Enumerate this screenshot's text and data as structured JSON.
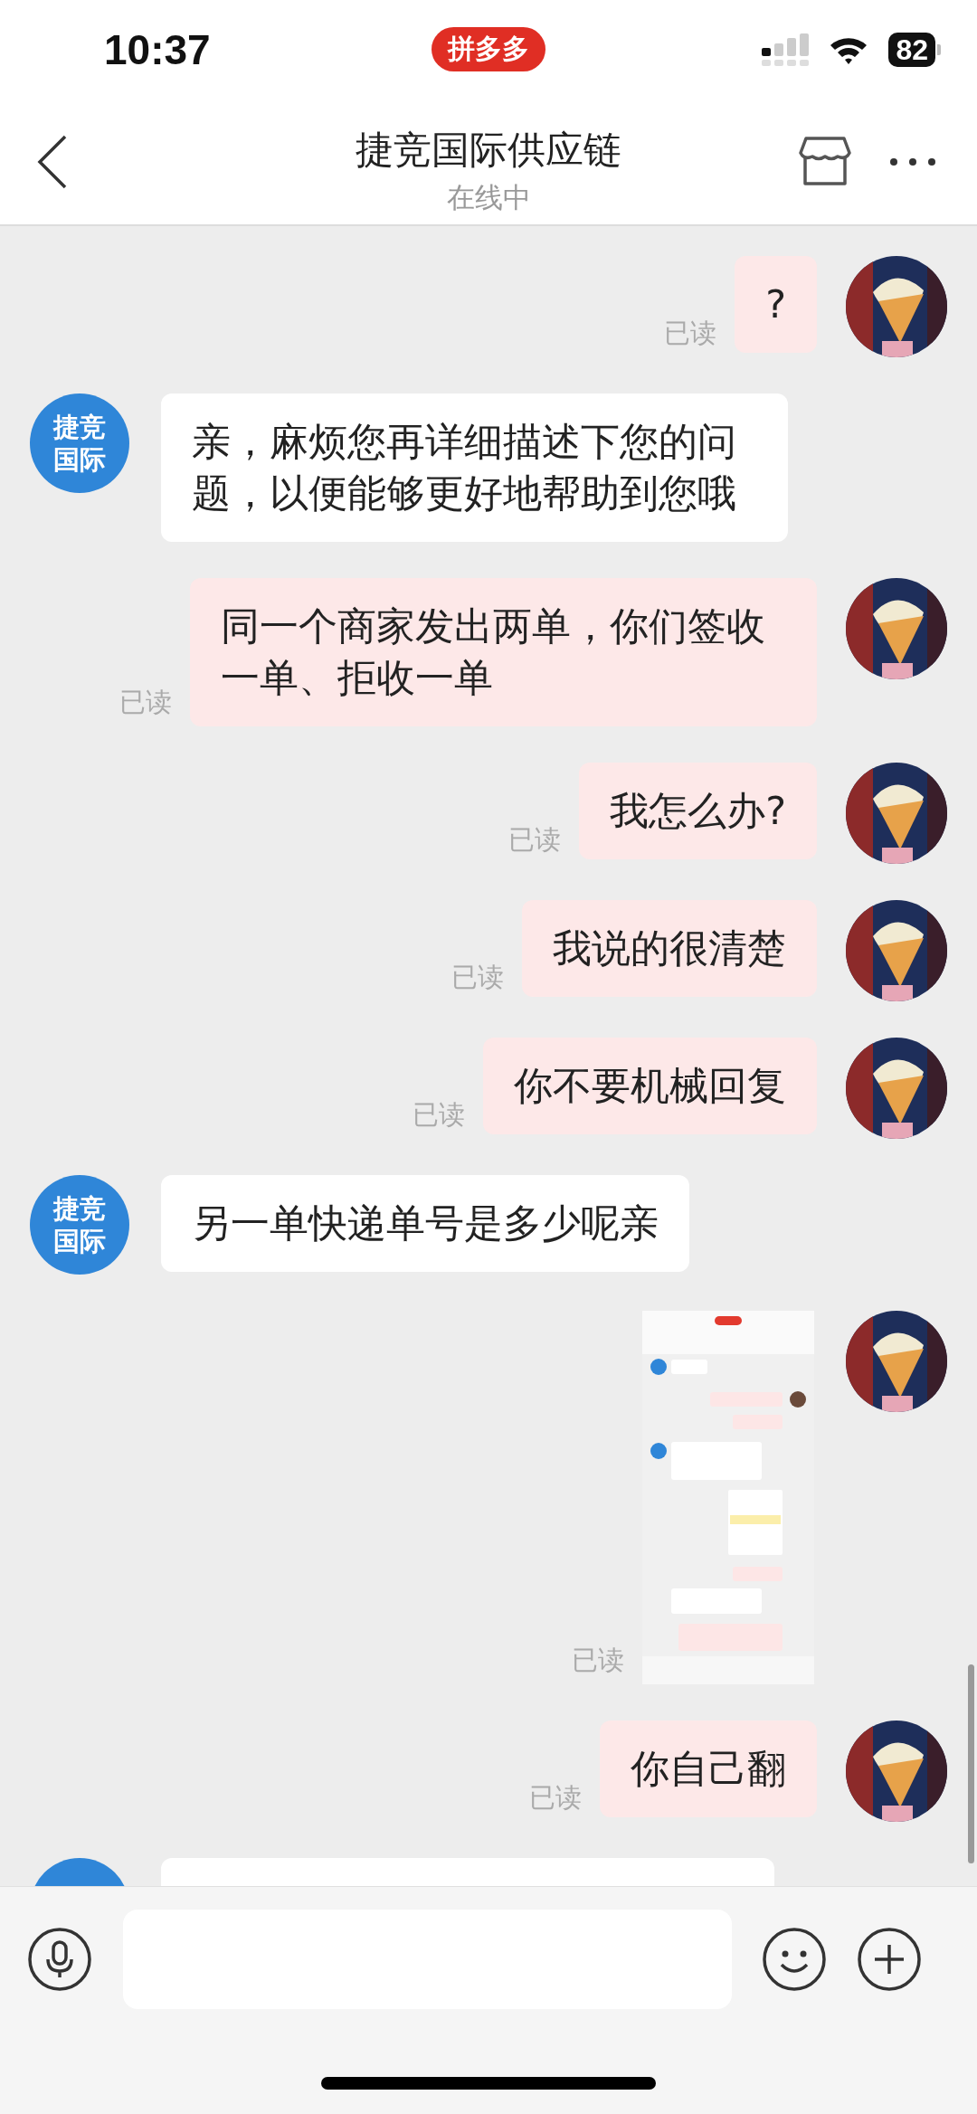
{
  "status_bar": {
    "time": "10:37",
    "app_badge": "拼多多",
    "battery": "82"
  },
  "header": {
    "title": "捷竞国际供应链",
    "subtitle": "在线中"
  },
  "messages": [
    {
      "outgoing": true,
      "kind": "text",
      "text": "?",
      "read": "已读"
    },
    {
      "outgoing": false,
      "kind": "text",
      "avatar_text": "捷竞国际",
      "text": "亲，麻烦您再详细描述下您的问题，以便能够更好地帮助到您哦"
    },
    {
      "outgoing": true,
      "kind": "text",
      "text": "同一个商家发出两单，你们签收一单、拒收一单",
      "read": "已读"
    },
    {
      "outgoing": true,
      "kind": "text",
      "text": "我怎么办?",
      "read": "已读"
    },
    {
      "outgoing": true,
      "kind": "text",
      "text": "我说的很清楚",
      "read": "已读"
    },
    {
      "outgoing": true,
      "kind": "text",
      "text": "你不要机械回复",
      "read": "已读"
    },
    {
      "outgoing": false,
      "kind": "text",
      "avatar_text": "捷竞国际",
      "text": "另一单快递单号是多少呢亲"
    },
    {
      "outgoing": true,
      "read": "已读"
    },
    {
      "outgoing": true,
      "kind": "text",
      "text": "你自己翻",
      "read": "已读"
    },
    {
      "outgoing": false,
      "kind": "cut"
    }
  ]
}
